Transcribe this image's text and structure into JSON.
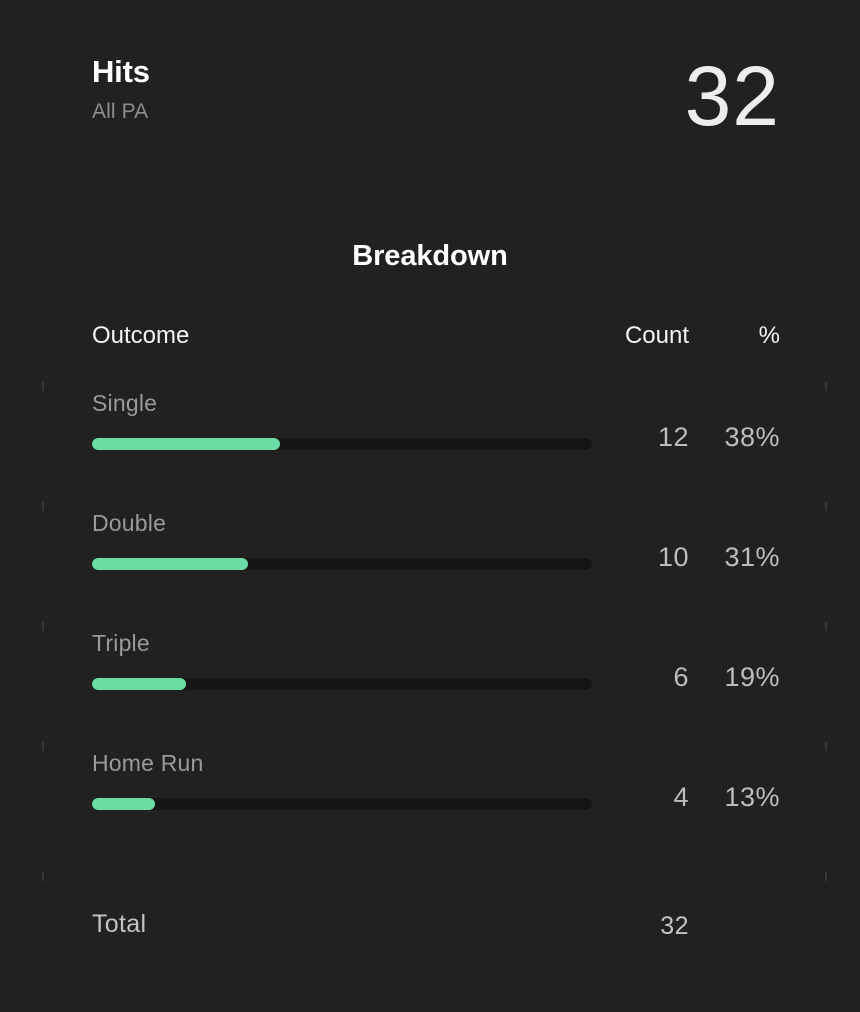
{
  "header": {
    "title": "Hits",
    "subtitle": "All PA",
    "value": "32"
  },
  "breakdown": {
    "heading": "Breakdown",
    "columns": {
      "outcome": "Outcome",
      "count": "Count",
      "percent": "%"
    },
    "rows": [
      {
        "label": "Single",
        "count": "12",
        "percent": "38%",
        "bar_pct": 37.5
      },
      {
        "label": "Double",
        "count": "10",
        "percent": "31%",
        "bar_pct": 31.2
      },
      {
        "label": "Triple",
        "count": "6",
        "percent": "19%",
        "bar_pct": 18.8
      },
      {
        "label": "Home Run",
        "count": "4",
        "percent": "13%",
        "bar_pct": 12.5
      }
    ],
    "total": {
      "label": "Total",
      "count": "32",
      "percent": ""
    }
  },
  "chart_data": {
    "type": "bar",
    "title": "Breakdown",
    "categories": [
      "Single",
      "Double",
      "Triple",
      "Home Run"
    ],
    "values": [
      12,
      10,
      6,
      4
    ],
    "percents": [
      38,
      31,
      19,
      13
    ],
    "total": 32,
    "xlabel": "Outcome",
    "ylabel": "Count",
    "ylim": [
      0,
      32
    ],
    "grid": false,
    "orientation": "horizontal"
  },
  "colors": {
    "background": "#212121",
    "bar_fill": "#6bdca3",
    "bar_track": "#151515",
    "text_primary": "#ffffff",
    "text_muted": "#9a9a9a",
    "text_value": "#bdbdbd"
  }
}
